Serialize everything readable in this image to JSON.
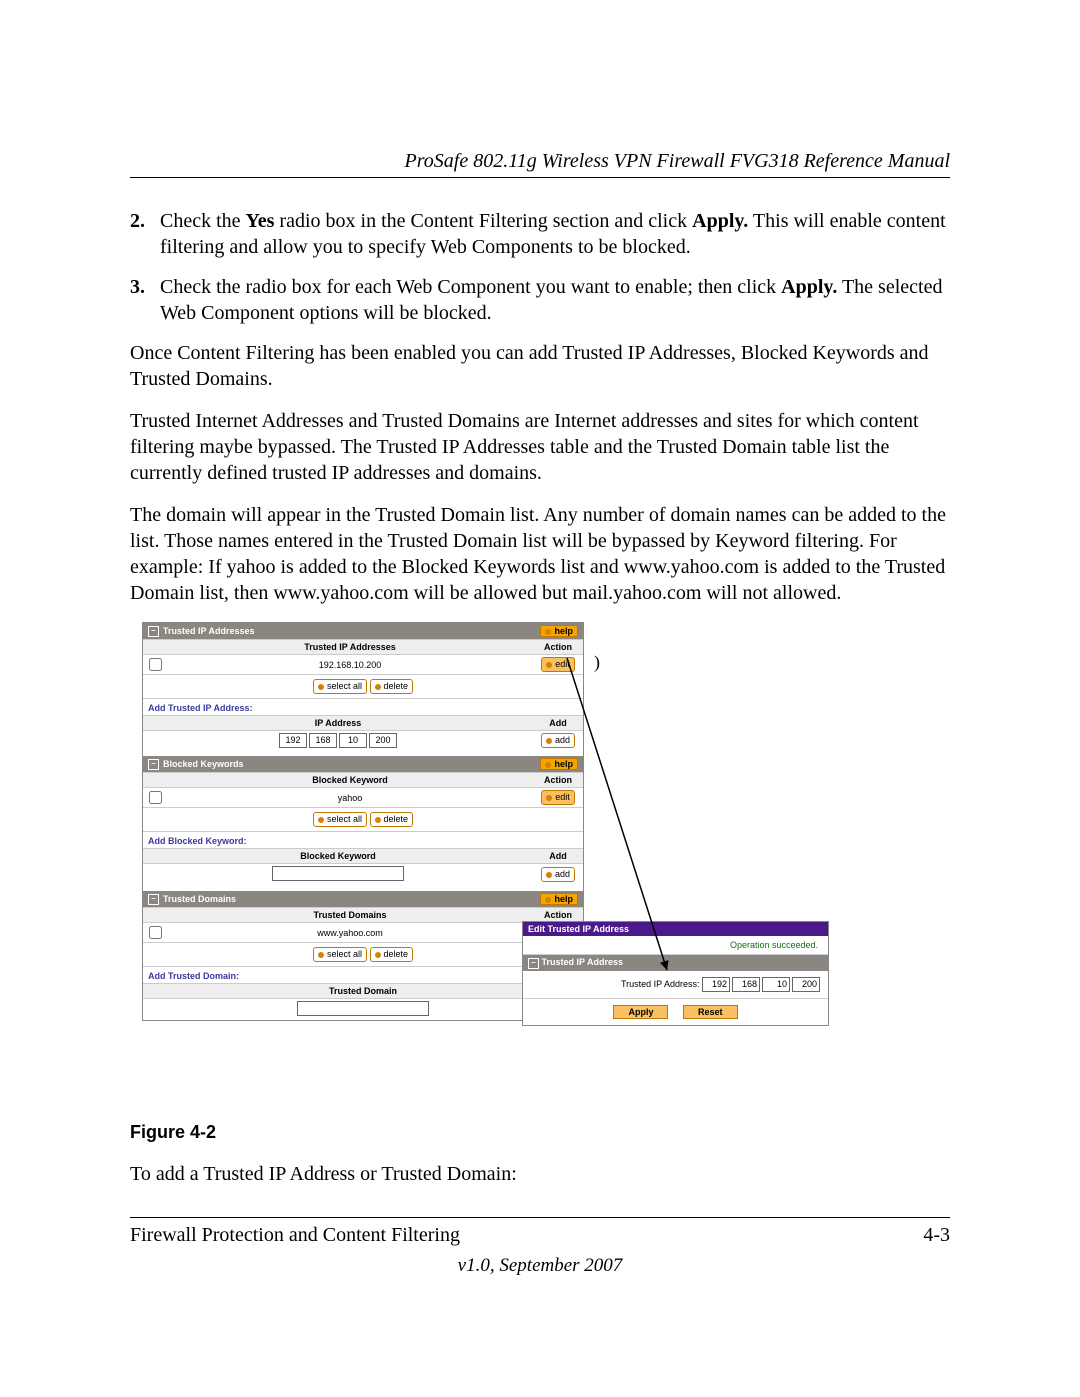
{
  "header": "ProSafe 802.11g Wireless VPN Firewall FVG318 Reference Manual",
  "steps": [
    {
      "num": "2.",
      "html": "Check the <b>Yes</b> radio box in the Content Filtering section and click <b>Apply.</b> This will enable content filtering and allow you to specify Web Components to be blocked."
    },
    {
      "num": "3.",
      "html": "Check the radio box for each Web Component you want to enable; then click <b>Apply.</b> The selected Web Component options will be blocked."
    }
  ],
  "paras": [
    "Once Content Filtering has been enabled you can add Trusted IP Addresses, Blocked Keywords and Trusted Domains.",
    "Trusted Internet Addresses and Trusted Domains are Internet addresses and sites for which content filtering maybe bypassed. The Trusted IP Addresses table and the Trusted Domain table list the currently defined trusted IP addresses and domains.",
    "The domain will appear in the Trusted Domain list. Any number of domain names can be added to the list. Those names entered in the Trusted Domain list will be bypassed by Keyword filtering. For example: If yahoo is added to the Blocked Keywords list and www.yahoo.com is added to the Trusted Domain list, then www.yahoo.com will be allowed but mail.yahoo.com will not allowed."
  ],
  "extraParen": ")",
  "ui": {
    "help": "help",
    "selectAll": "select all",
    "delete": "delete",
    "edit": "edit",
    "add": "add",
    "addHeader": "Add",
    "actionHeader": "Action",
    "trustedIP": {
      "title": "Trusted IP Addresses",
      "header": "Trusted IP Addresses",
      "row": "192.168.10.200",
      "addTitle": "Add Trusted IP Address:",
      "ipHeader": "IP Address",
      "ip": [
        "192",
        "168",
        "10",
        "200"
      ]
    },
    "blockedKw": {
      "title": "Blocked Keywords",
      "header": "Blocked Keyword",
      "row": "yahoo",
      "addTitle": "Add Blocked Keyword:",
      "kwHeader": "Blocked Keyword"
    },
    "trustedDom": {
      "title": "Trusted Domains",
      "header": "Trusted Domains",
      "row": "www.yahoo.com",
      "addTitle": "Add Trusted Domain:",
      "domHeader": "Trusted Domain"
    }
  },
  "dialog": {
    "title": "Edit Trusted IP Address",
    "msg": "Operation succeeded.",
    "section": "Trusted IP Address",
    "label": "Trusted IP Address:",
    "ip": [
      "192",
      "168",
      "10",
      "200"
    ],
    "apply": "Apply",
    "reset": "Reset"
  },
  "figLabel": "Figure 4-2",
  "afterFig": "To add a Trusted IP Address or Trusted Domain:",
  "footerLeft": "Firewall Protection and Content Filtering",
  "footerRight": "4-3",
  "footerVer": "v1.0, September 2007"
}
